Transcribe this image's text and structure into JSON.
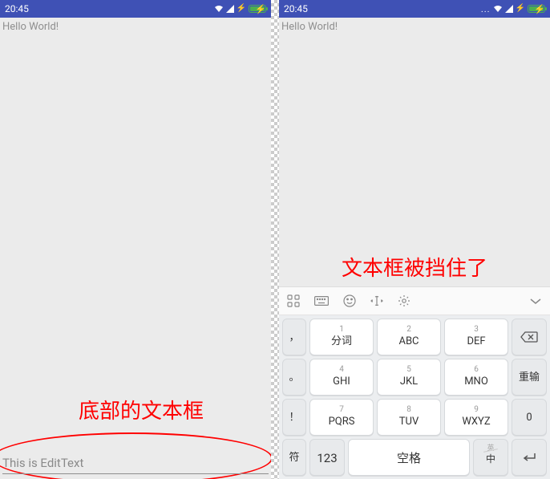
{
  "status": {
    "time": "20:45",
    "wifi_icon": "wifi",
    "signal_icon": "signal",
    "dots": "..."
  },
  "left": {
    "hello": "Hello World!",
    "annotation": "底部的文本框",
    "edittext_value": "This is EditText"
  },
  "right": {
    "hello": "Hello World!",
    "annotation": "文本框被挡住了"
  },
  "keyboard": {
    "rows": [
      [
        {
          "side": true,
          "lbl": "，"
        },
        {
          "num": "1",
          "lbl": "分词"
        },
        {
          "num": "2",
          "lbl": "ABC"
        },
        {
          "num": "3",
          "lbl": "DEF"
        },
        {
          "side": true,
          "icon": "backspace"
        }
      ],
      [
        {
          "side": true,
          "lbl": "。"
        },
        {
          "num": "4",
          "lbl": "GHI"
        },
        {
          "num": "5",
          "lbl": "JKL"
        },
        {
          "num": "6",
          "lbl": "MNO"
        },
        {
          "side": true,
          "lbl": "重输"
        }
      ],
      [
        {
          "side": true,
          "lbl": "！"
        },
        {
          "num": "7",
          "lbl": "PQRS"
        },
        {
          "num": "8",
          "lbl": "TUV"
        },
        {
          "num": "9",
          "lbl": "WXYZ"
        },
        {
          "side": true,
          "lbl": "0"
        }
      ]
    ],
    "bottom": {
      "sym": "符",
      "num": "123",
      "space": "空格",
      "lang_top": "英",
      "lang_bot": "中",
      "enter": "enter"
    }
  }
}
